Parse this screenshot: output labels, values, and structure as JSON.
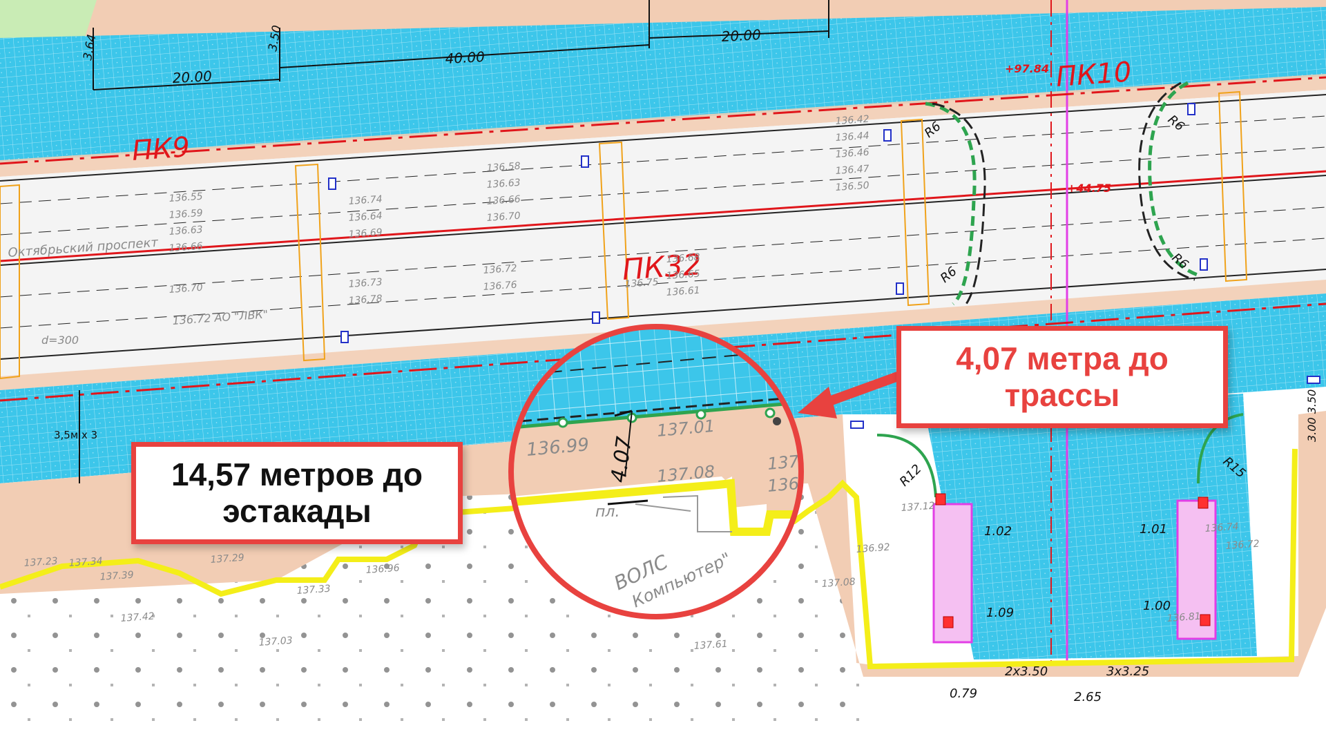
{
  "colors": {
    "water": "#3cc6ea",
    "sidewalk": "#f2cdb4",
    "road": "#f4f4f4",
    "boundary": "#f4ee19",
    "red_line": "#e0161b",
    "callout_border": "#e8423f",
    "magenta": "#e23ee6"
  },
  "labels": {
    "pk9": "ПК9",
    "pk10": "ПК10",
    "pk32": "ПК32",
    "plus_9784": "+97.84",
    "plus_4475": "+44.75",
    "oktyabrsky": "Октябрьский проспект",
    "lvk": "136.72 АО \"ЛВК\"",
    "d300": "d=300",
    "volc": "ВОЛС",
    "computer": "Компьютер\"",
    "pl": "пл."
  },
  "dimensions": {
    "d1": "20.00",
    "d2": "40.00",
    "d3": "20.00",
    "d4": "3.64",
    "d5": "3.50",
    "lanes": "3,5м х 3",
    "r6a": "R6",
    "r6b": "R6",
    "r6c": "R6",
    "r6d": "R6",
    "r12": "R12",
    "r15": "R15",
    "d102": "1.02",
    "d109": "1.09",
    "d101": "1.01",
    "d100": "1.00",
    "d079": "0.79",
    "d265": "2.65",
    "d2x350": "2x3.50",
    "d3x325": "3x3.25",
    "d350r": "3.00 3.50"
  },
  "elevations": [
    "136.58",
    "136.63",
    "136.66",
    "136.70",
    "136.68",
    "136.65",
    "136.61",
    "136.55",
    "136.59",
    "136.63",
    "136.66",
    "136.70",
    "136.74",
    "136.64",
    "136.69",
    "136.73",
    "136.75",
    "136.78",
    "136.72",
    "136.76",
    "136.42",
    "136.44",
    "136.46",
    "136.47",
    "136.50",
    "137.23",
    "137.34",
    "137.39",
    "137.29",
    "137.33",
    "136.96",
    "137.03",
    "137.42",
    "137.12",
    "136.92",
    "137.08",
    "136.81",
    "137.61",
    "136.74",
    "136.72"
  ],
  "inset": {
    "elev1": "136.99",
    "elev2": "137.01",
    "elev3": "137.08",
    "elev4": "137.",
    "elev5": "136.",
    "dim": "4.07"
  },
  "callouts": {
    "left_line1": "14,57 метров до",
    "left_line2": "эстакады",
    "right_line1": "4,07 метра до",
    "right_line2": "трассы"
  }
}
